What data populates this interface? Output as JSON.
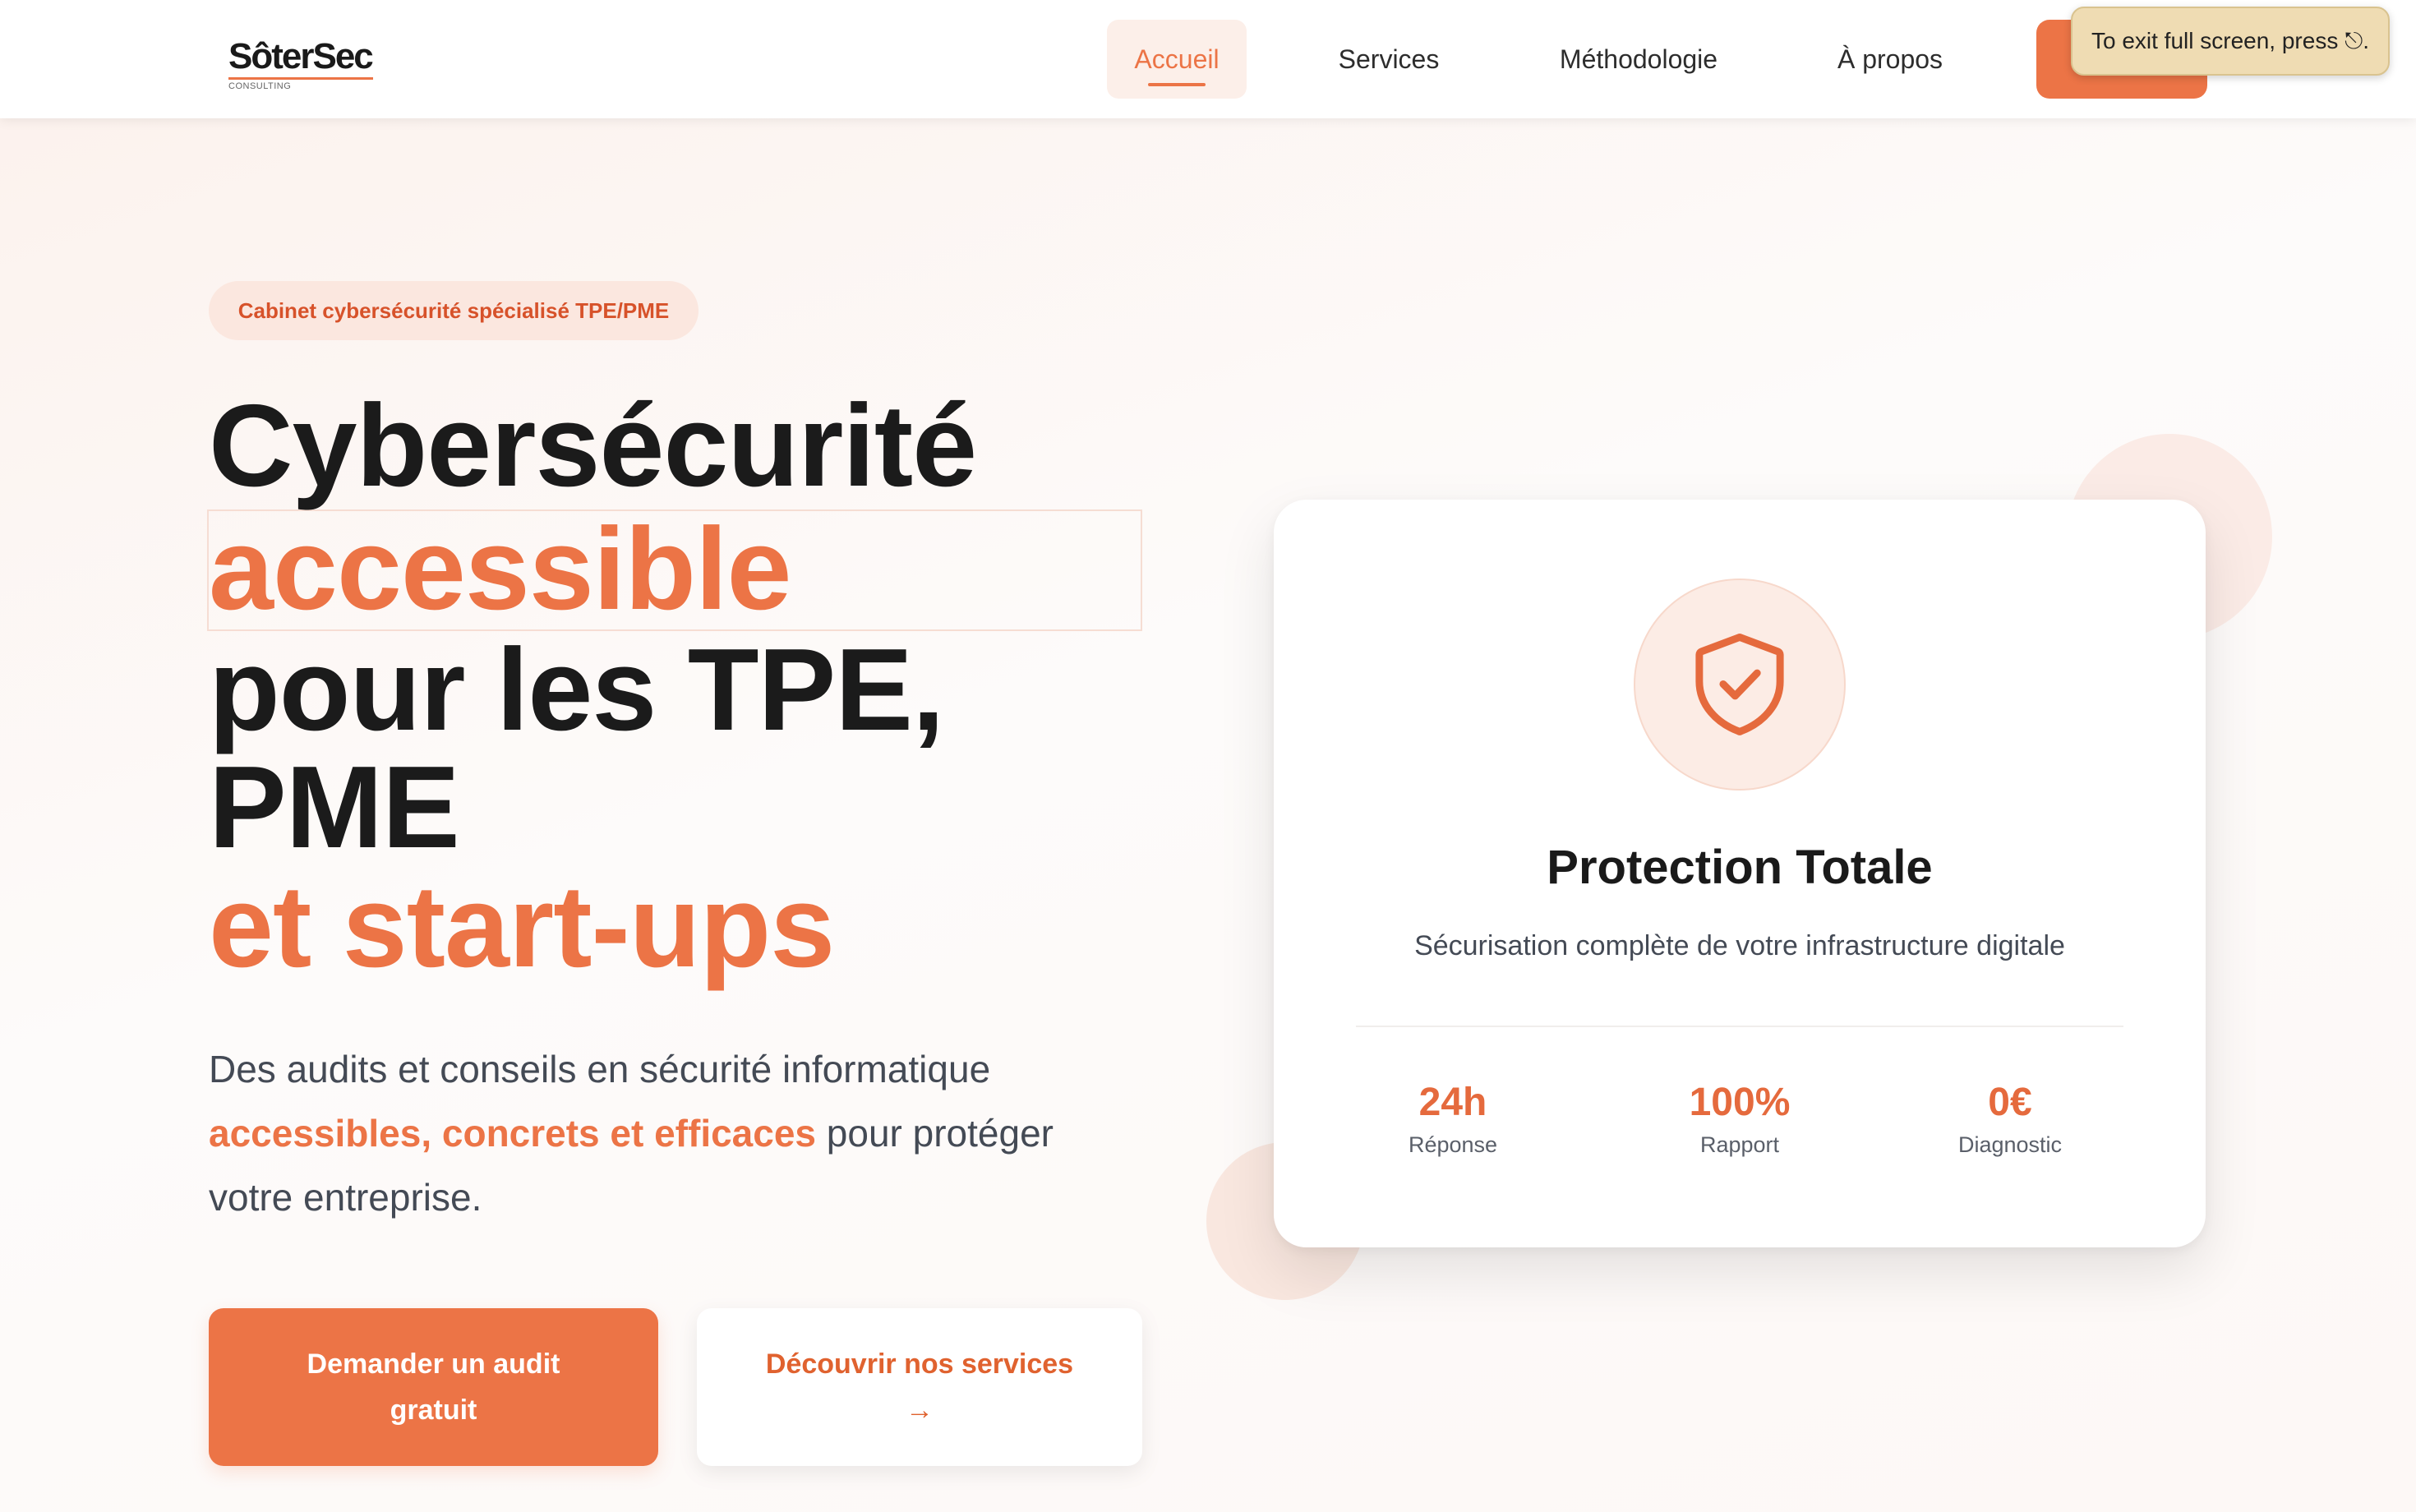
{
  "brand": {
    "logo_text": "SôterSec",
    "logo_sub": "CONSULTING"
  },
  "nav": {
    "items": [
      {
        "label": "Accueil",
        "active": true
      },
      {
        "label": "Services",
        "active": false
      },
      {
        "label": "Méthodologie",
        "active": false
      },
      {
        "label": "À propos",
        "active": false
      }
    ],
    "cta_label": ""
  },
  "fullscreen_notice": "To exit full screen, press ⎋.",
  "hero": {
    "badge": "Cabinet cybersécurité spécialisé TPE/PME",
    "title_lines": [
      "Cybersécurité",
      "accessible",
      "pour les TPE,",
      "PME",
      "et start-ups"
    ],
    "description": {
      "part1": "Des audits et conseils en sécurité informatique",
      "highlight": "accessibles, concrets et efficaces",
      "part2": " pour protéger",
      "part3": "votre entreprise."
    },
    "primary_button": "Demander un audit gratuit",
    "secondary_button": "Découvrir nos services",
    "secondary_arrow": "→"
  },
  "card": {
    "icon": "shield-check-icon",
    "title": "Protection Totale",
    "subtitle": "Sécurisation complète de votre infrastructure digitale",
    "stats": [
      {
        "value": "24h",
        "label": "Réponse"
      },
      {
        "value": "100%",
        "label": "Rapport"
      },
      {
        "value": "0€",
        "label": "Diagnostic"
      }
    ]
  },
  "colors": {
    "accent": "#ec7446",
    "accent_dark": "#d7522a",
    "text_dark": "#1b1b1b",
    "text_body": "#444a55",
    "badge_bg": "#fbe7df"
  }
}
